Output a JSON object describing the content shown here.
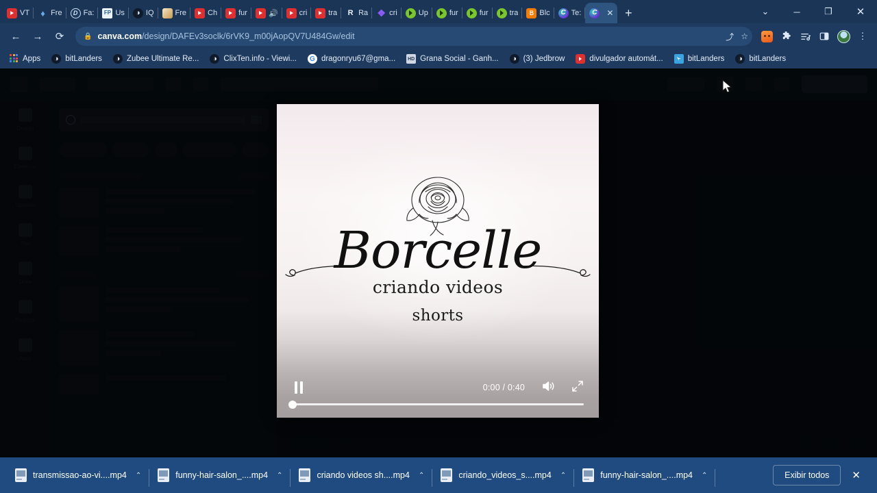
{
  "browser": {
    "tabs": [
      {
        "label": "VT",
        "icon": "youtube-icon",
        "icon_class": "fav-yt",
        "active": false
      },
      {
        "label": "Fre",
        "icon": "droplet-icon",
        "icon_class": "fav-drop",
        "glyph": "◆",
        "active": false
      },
      {
        "label": "Fa:",
        "icon": "d-letter-icon",
        "icon_class": "fav-d",
        "glyph": "D",
        "active": false
      },
      {
        "label": "Us",
        "icon": "fp-icon",
        "icon_class": "fav-fp",
        "glyph": "FP",
        "active": false
      },
      {
        "label": "IQ",
        "icon": "globe-icon",
        "icon_class": "fav-globe",
        "glyph": "◑",
        "active": false
      },
      {
        "label": "Fre",
        "icon": "book-icon",
        "icon_class": "fav-book",
        "glyph": "",
        "active": false
      },
      {
        "label": "Ch",
        "icon": "youtube-icon",
        "icon_class": "fav-yt",
        "active": false
      },
      {
        "label": "fur",
        "icon": "youtube-icon",
        "icon_class": "fav-yt",
        "active": false
      },
      {
        "label": "🔊",
        "icon": "youtube-icon",
        "icon_class": "fav-yt",
        "active": false
      },
      {
        "label": "cri",
        "icon": "youtube-icon",
        "icon_class": "fav-yt",
        "active": false
      },
      {
        "label": "tra",
        "icon": "youtube-icon",
        "icon_class": "fav-yt",
        "active": false
      },
      {
        "label": "Ra",
        "icon": "r-letter-icon",
        "icon_class": "fav-globe",
        "glyph": "R",
        "active": false
      },
      {
        "label": "cri",
        "icon": "diamond-icon",
        "icon_class": "fav-diamond",
        "glyph": "❖",
        "active": false
      },
      {
        "label": "Up",
        "icon": "play-green-icon",
        "icon_class": "fav-green",
        "active": false
      },
      {
        "label": "fur",
        "icon": "play-green-icon",
        "icon_class": "fav-green",
        "active": false
      },
      {
        "label": "fur",
        "icon": "play-green-icon",
        "icon_class": "fav-green",
        "active": false
      },
      {
        "label": "tra",
        "icon": "play-green-icon",
        "icon_class": "fav-green",
        "active": false
      },
      {
        "label": "Blc",
        "icon": "blogger-icon",
        "icon_class": "fav-blog",
        "glyph": "B",
        "active": false
      },
      {
        "label": "Te:",
        "icon": "canva-icon",
        "icon_class": "fav-canva",
        "glyph": "C",
        "active": false
      },
      {
        "label": "",
        "icon": "canva-icon",
        "icon_class": "fav-canva",
        "glyph": "C",
        "active": true
      }
    ],
    "new_tab_label": "+",
    "tab_close_label": "✕",
    "window_controls": {
      "tab_search": "⌄",
      "minimize": "─",
      "maximize": "❐",
      "close": "✕"
    },
    "nav": {
      "back": "←",
      "forward": "→",
      "reload": "⟳"
    },
    "omnibox": {
      "lock": "🔒",
      "domain": "canva.com",
      "path": "/design/DAFEv3soclk/6rVK9_m00jAopQV7U484Gw/edit",
      "share_icon": "⤴",
      "star_icon": "☆"
    },
    "toolbar_icons": [
      {
        "name": "extension-fox-icon",
        "glyph": ""
      },
      {
        "name": "extensions-puzzle-icon",
        "glyph": "🧩"
      },
      {
        "name": "reading-list-icon",
        "glyph": "☰"
      },
      {
        "name": "side-panel-icon",
        "glyph": "◫"
      },
      {
        "name": "profile-avatar",
        "glyph": ""
      },
      {
        "name": "chrome-menu-icon",
        "glyph": "⋮"
      }
    ],
    "bookmarks": [
      {
        "label": "Apps",
        "icon": "apps-grid-icon"
      },
      {
        "label": "bitLanders",
        "icon": "globe-icon"
      },
      {
        "label": "Zubee Ultimate Re...",
        "icon": "globe-icon"
      },
      {
        "label": "ClixTen.info - Viewi...",
        "icon": "globe-icon"
      },
      {
        "label": "dragonryu67@gma...",
        "icon": "google-icon"
      },
      {
        "label": "Grana Social - Ganh...",
        "icon": "hd-icon"
      },
      {
        "label": "(3) Jedbrow",
        "icon": "globe-icon"
      },
      {
        "label": "divulgador automát...",
        "icon": "youtube-icon"
      },
      {
        "label": "bitLanders",
        "icon": "blue-arrow-icon"
      },
      {
        "label": "bitLanders",
        "icon": "globe-icon"
      }
    ]
  },
  "canva_editor": {
    "sidebar_items": [
      {
        "label": "Design"
      },
      {
        "label": "Elements"
      },
      {
        "label": "Uploads"
      },
      {
        "label": "Text"
      },
      {
        "label": "Draw"
      },
      {
        "label": "Projects"
      },
      {
        "label": "Apps"
      }
    ]
  },
  "video_preview": {
    "brand_name": "Borcelle",
    "subtitle_1": "criando videos",
    "subtitle_2": "shorts",
    "controls": {
      "pause_label": "Pause",
      "time_display": "0:00 / 0:40",
      "current_time": "0:00",
      "duration": "0:40",
      "volume_label": "Volume",
      "fullscreen_label": "Fullscreen",
      "progress_percent": 0
    }
  },
  "download_bar": {
    "items": [
      {
        "name": "transmissao-ao-vi....mp4",
        "caret": "⌃"
      },
      {
        "name": "funny-hair-salon_....mp4",
        "caret": "⌃"
      },
      {
        "name": "criando videos sh....mp4",
        "caret": "⌃"
      },
      {
        "name": "criando_videos_s....mp4",
        "caret": "⌃"
      },
      {
        "name": "funny-hair-salon_....mp4",
        "caret": "⌃"
      }
    ],
    "show_all_label": "Exibir todos",
    "close_label": "✕"
  },
  "colors": {
    "chrome_blue": "#1f3a5f",
    "tab_active": "#2e5580",
    "download_bar": "#1f4b80",
    "page_dim": "#0d1824"
  }
}
